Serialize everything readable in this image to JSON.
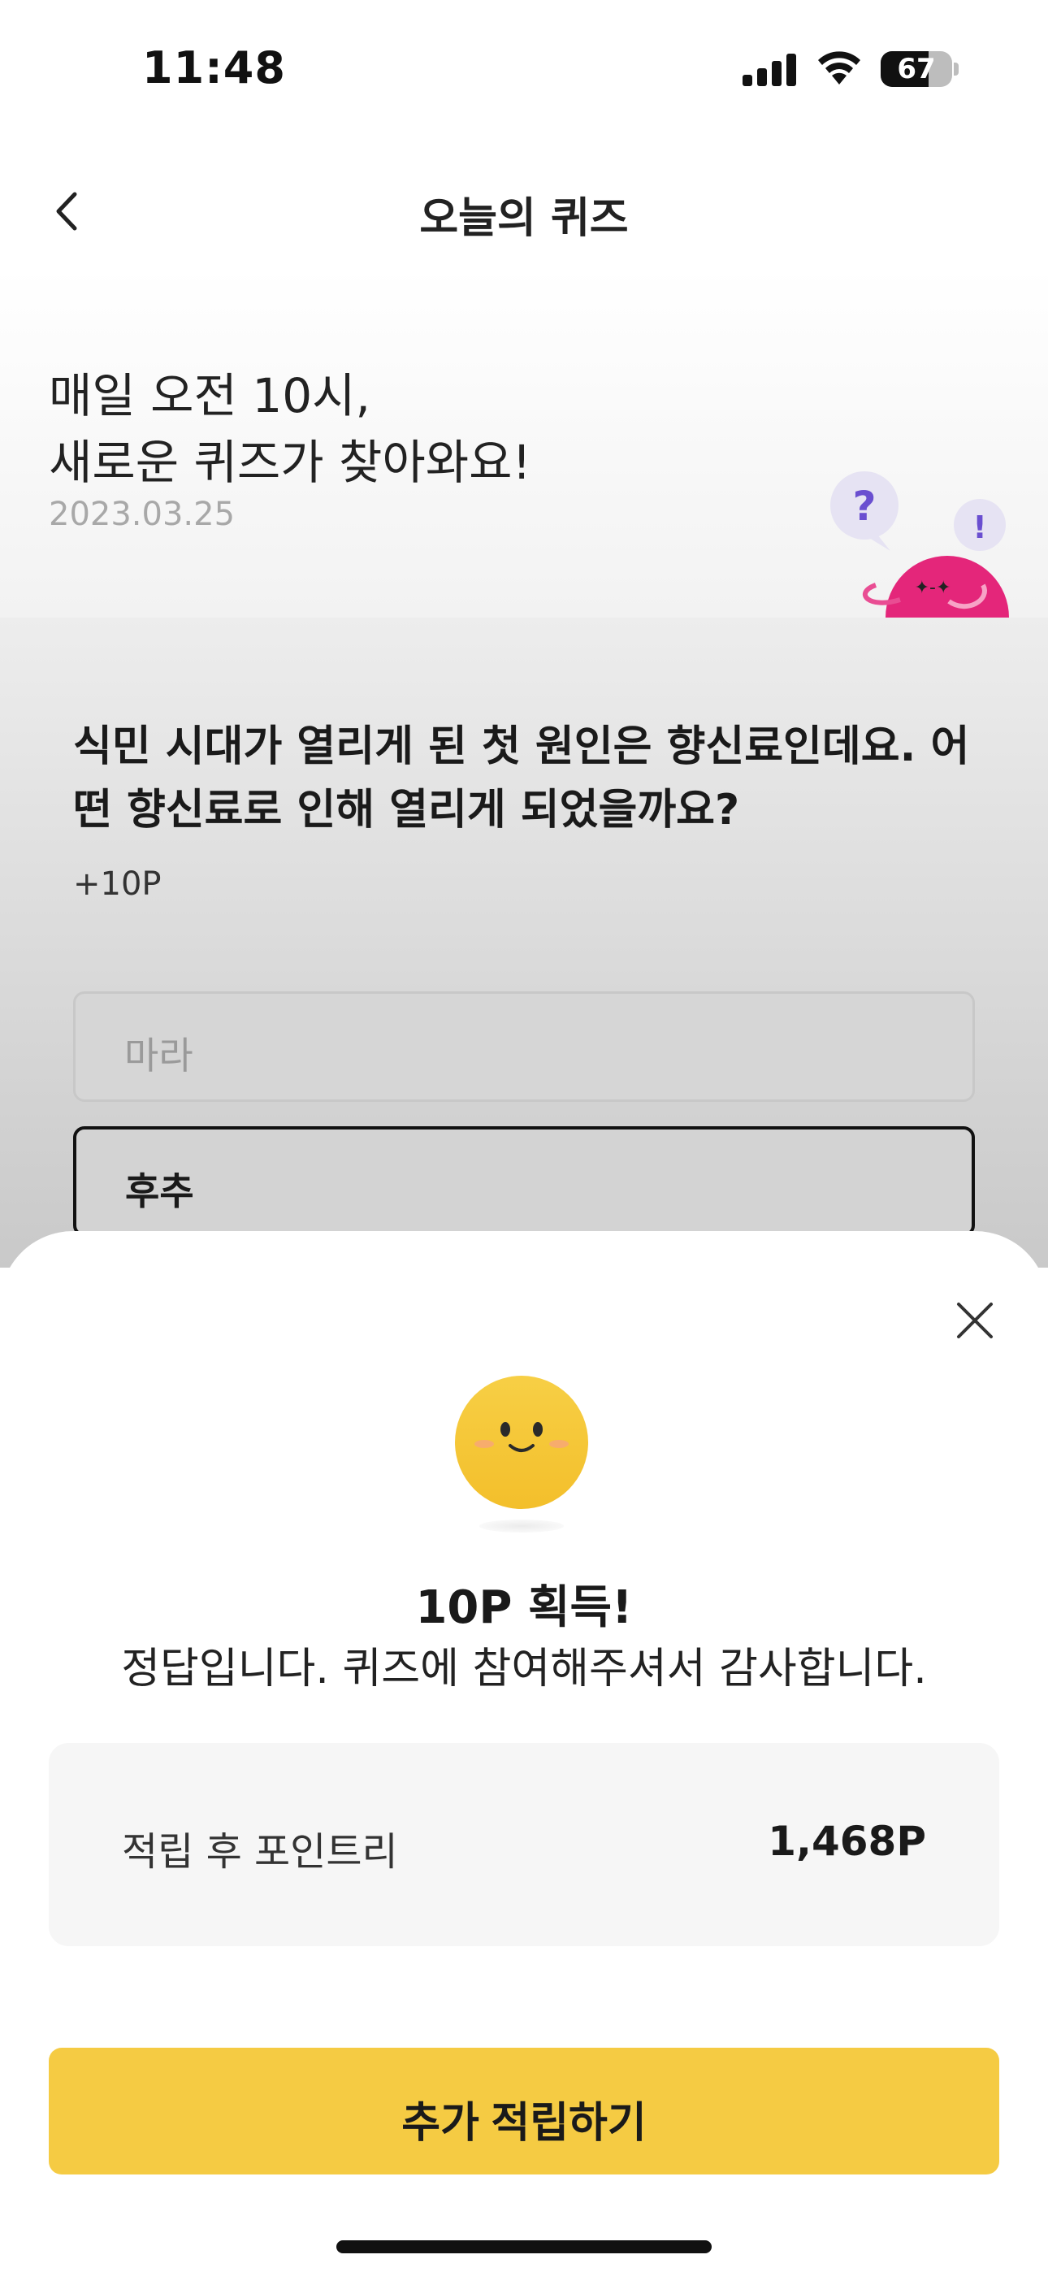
{
  "status_bar": {
    "time": "11:48",
    "battery": "67",
    "battery_level": 0.67
  },
  "nav": {
    "title": "오늘의 퀴즈",
    "back_icon": "chevron-left-icon"
  },
  "intro": {
    "line1": "매일 오전 10시,",
    "line2": "새로운 퀴즈가 찾아와요!",
    "date": "2023.03.25",
    "bubble_left": "?",
    "bubble_right": "!"
  },
  "quiz": {
    "question": "식민 시대가 열리게 된 첫 원인은 향신료인데요. 어떤 향신료로 인해 열리게 되었을까요?",
    "points": "+10P",
    "options": [
      {
        "label": "마라"
      },
      {
        "label": "후추"
      }
    ]
  },
  "result_sheet": {
    "close_icon": "close-icon",
    "title": "10P 획득!",
    "message": "정답입니다. 퀴즈에 참여해주셔서 감사합니다.",
    "points_label": "적립 후 포인트리",
    "points_value": "1,468P",
    "cta_label": "추가 적립하기"
  },
  "colors": {
    "accent_yellow": "#f5cb43",
    "mascot_pink": "#e4267a",
    "bubble_purple": "#6a4fd0"
  }
}
